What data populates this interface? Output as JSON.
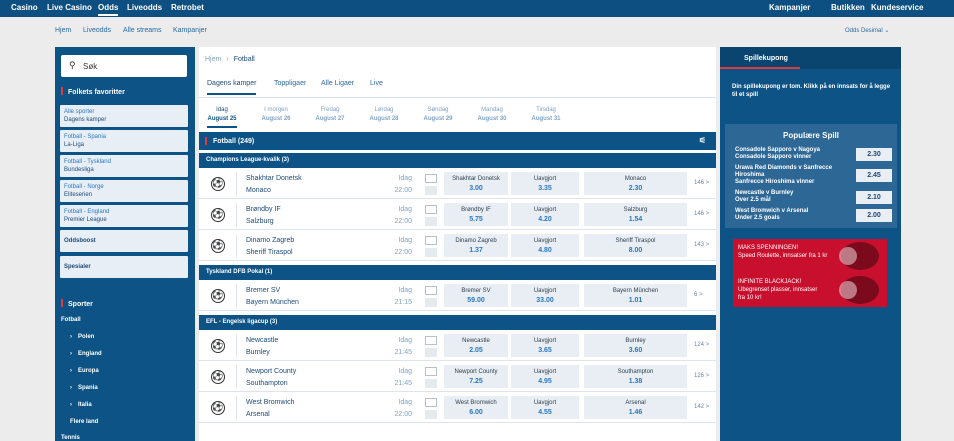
{
  "topnav": {
    "left": [
      "Casino",
      "Live Casino",
      "Odds",
      "Liveodds",
      "Retrobet"
    ],
    "active": "Odds",
    "right": [
      "Kampanjer",
      "Butikken",
      "Kundeservice"
    ]
  },
  "subnav": {
    "links": [
      "Hjem",
      "Liveodds",
      "Alle streams",
      "Kampanjer"
    ],
    "odds_format": "Odds Desimal"
  },
  "sidebar": {
    "search_label": "Søk",
    "favorites_title": "Folkets favoritter",
    "favorites": [
      {
        "l1": "Alle sporter",
        "l2": "Dagens kamper"
      },
      {
        "l1": "Fotball - Spania",
        "l2": "La-Liga"
      },
      {
        "l1": "Fotball - Tyskland",
        "l2": "Bundesliga"
      },
      {
        "l1": "Fotball - Norge",
        "l2": "Eliteserien"
      },
      {
        "l1": "Fotball - England",
        "l2": "Premier League"
      }
    ],
    "singles": [
      "Oddsboost",
      "Spesialer"
    ],
    "sports_title": "Sporter",
    "sport": "Fotball",
    "regions": [
      "Polen",
      "England",
      "Europa",
      "Spania",
      "Italia"
    ],
    "more": "Flere land",
    "tennis": "Tennis"
  },
  "main": {
    "breadcrumb": [
      "Hjem",
      "Fotball"
    ],
    "tabs": [
      "Dagens kamper",
      "Toppligaer",
      "Alle Ligaer",
      "Live"
    ],
    "days": [
      {
        "d1": "Idag",
        "d2": "August 25"
      },
      {
        "d1": "I morgen",
        "d2": "August 26"
      },
      {
        "d1": "Fredag",
        "d2": "August 27"
      },
      {
        "d1": "Lørdag",
        "d2": "August 28"
      },
      {
        "d1": "Søndag",
        "d2": "August 29"
      },
      {
        "d1": "Mandag",
        "d2": "August 30"
      },
      {
        "d1": "Tirsdag",
        "d2": "August 31"
      }
    ],
    "section_title": "Fotball",
    "section_count": "(249)",
    "leagues": [
      {
        "name": "Champions League-kvalik (3)",
        "matches": [
          {
            "home": "Shakhtar Donetsk",
            "away": "Monaco",
            "day": "Idag",
            "time": "22:00",
            "o1": {
              "n": "Shakhtar Donetsk",
              "v": "3.00"
            },
            "ox": {
              "n": "Uavgjort",
              "v": "3.35"
            },
            "o2": {
              "n": "Monaco",
              "v": "2.30"
            },
            "more": "146 >"
          },
          {
            "home": "Brøndby IF",
            "away": "Salzburg",
            "day": "Idag",
            "time": "22:00",
            "o1": {
              "n": "Brøndby IF",
              "v": "5.75"
            },
            "ox": {
              "n": "Uavgjort",
              "v": "4.20"
            },
            "o2": {
              "n": "Salzburg",
              "v": "1.54"
            },
            "more": "146 >"
          },
          {
            "home": "Dinamo Zagreb",
            "away": "Sheriff Tiraspol",
            "day": "Idag",
            "time": "22:00",
            "o1": {
              "n": "Dinamo Zagreb",
              "v": "1.37"
            },
            "ox": {
              "n": "Uavgjort",
              "v": "4.80"
            },
            "o2": {
              "n": "Sheriff Tiraspol",
              "v": "8.00"
            },
            "more": "143 >"
          }
        ]
      },
      {
        "name": "Tyskland DFB Pokal (1)",
        "matches": [
          {
            "home": "Bremer SV",
            "away": "Bayern München",
            "day": "Idag",
            "time": "21:15",
            "o1": {
              "n": "Bremer SV",
              "v": "59.00"
            },
            "ox": {
              "n": "Uavgjort",
              "v": "33.00"
            },
            "o2": {
              "n": "Bayern München",
              "v": "1.01"
            },
            "more": "6 >"
          }
        ]
      },
      {
        "name": "EFL - Engelsk ligacup (3)",
        "matches": [
          {
            "home": "Newcastle",
            "away": "Burnley",
            "day": "Idag",
            "time": "21:45",
            "o1": {
              "n": "Newcastle",
              "v": "2.05"
            },
            "ox": {
              "n": "Uavgjort",
              "v": "3.65"
            },
            "o2": {
              "n": "Burnley",
              "v": "3.60"
            },
            "more": "124 >"
          },
          {
            "home": "Newport County",
            "away": "Southampton",
            "day": "Idag",
            "time": "21:45",
            "o1": {
              "n": "Newport County",
              "v": "7.25"
            },
            "ox": {
              "n": "Uavgjort",
              "v": "4.95"
            },
            "o2": {
              "n": "Southampton",
              "v": "1.38"
            },
            "more": "126 >"
          },
          {
            "home": "West Bromwich",
            "away": "Arsenal",
            "day": "Idag",
            "time": "22:00",
            "o1": {
              "n": "West Bromwich",
              "v": "6.00"
            },
            "ox": {
              "n": "Uavgjort",
              "v": "4.55"
            },
            "o2": {
              "n": "Arsenal",
              "v": "1.46"
            },
            "more": "142 >"
          }
        ]
      }
    ]
  },
  "slip": {
    "tab": "Spillekupong",
    "empty": "Din spillekupong er tom. Klikk på en innsats for å legge til et spill",
    "popular_title": "Populære Spill",
    "popular": [
      {
        "lines": [
          "Consadole Sapporo v Nagoya",
          "Consadole Sapporo vinner"
        ],
        "odds": "2.30"
      },
      {
        "lines": [
          "Urawa Red Diamonds v Sanfrecce",
          "Hiroshima",
          "Sanfrecce Hiroshima vinner"
        ],
        "odds": "2.45"
      },
      {
        "lines": [
          "Newcastle v Burnley",
          "Over 2.5 mål"
        ],
        "odds": "2.10"
      },
      {
        "lines": [
          "West Bromwich v Arsenal",
          "Under 2.5 goals"
        ],
        "odds": "2.00"
      }
    ],
    "banners": [
      {
        "l1": "MAKS SPENNINGEN!",
        "l2": "Speed Roulette, innsatser fra 1 kr"
      },
      {
        "l1": "INFINITE BLACKJACK!",
        "l2": "Ubegrenset plasser, innsatser",
        "l3": "fra 10 kr!"
      }
    ]
  },
  "colors": {
    "primary": "#0d5385",
    "accent": "#e03a3e",
    "odd_bg": "#e8eef3"
  }
}
